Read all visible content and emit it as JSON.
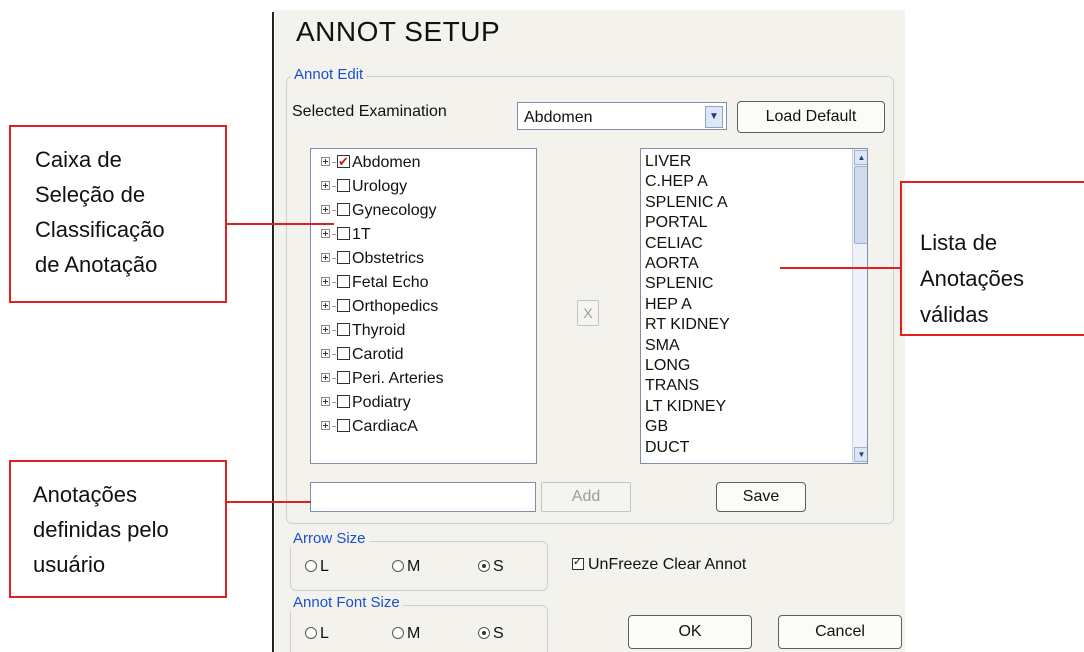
{
  "dialog": {
    "title": "ANNOT SETUP",
    "annot_edit": {
      "legend": "Annot Edit",
      "selected_examination_label": "Selected Examination",
      "selected_examination_value": "Abdomen",
      "load_default_label": "Load Default",
      "tree_items": [
        {
          "label": "Abdomen",
          "checked": true
        },
        {
          "label": "Urology",
          "checked": false
        },
        {
          "label": "Gynecology",
          "checked": false
        },
        {
          "label": "1T",
          "checked": false
        },
        {
          "label": "Obstetrics",
          "checked": false
        },
        {
          "label": "Fetal Echo",
          "checked": false
        },
        {
          "label": "Orthopedics",
          "checked": false
        },
        {
          "label": "Thyroid",
          "checked": false
        },
        {
          "label": "Carotid",
          "checked": false
        },
        {
          "label": "Peri. Arteries",
          "checked": false
        },
        {
          "label": "Podiatry",
          "checked": false
        },
        {
          "label": "CardiacA",
          "checked": false
        }
      ],
      "remove_button_label": "X",
      "annotations": [
        "LIVER",
        "C.HEP A",
        "SPLENIC A",
        "PORTAL",
        "CELIAC",
        "AORTA",
        "SPLENIC",
        "HEP A",
        "RT KIDNEY",
        "SMA",
        "LONG",
        "TRANS",
        "LT KIDNEY",
        "GB",
        "DUCT"
      ],
      "user_annotation_value": "",
      "add_button_label": "Add",
      "save_button_label": "Save"
    },
    "arrow_size": {
      "legend": "Arrow Size",
      "options": [
        "L",
        "M",
        "S"
      ],
      "selected": "S"
    },
    "annot_font_size": {
      "legend": "Annot Font Size",
      "options": [
        "L",
        "M",
        "S"
      ],
      "selected": "S"
    },
    "unfreeze_clear_annot": {
      "label": "UnFreeze Clear Annot",
      "checked": true
    },
    "ok_label": "OK",
    "cancel_label": "Cancel"
  },
  "callouts": {
    "classification": [
      "Caixa de",
      "Seleção de",
      "Classificação",
      "de Anotação"
    ],
    "annotation_list": [
      "Lista de",
      "Anotações",
      "válidas"
    ],
    "user_defined": [
      "Anotações",
      "definidas pelo",
      "usuário"
    ]
  },
  "colors": {
    "legend": "#1a4fcf",
    "callout_border": "#e02020",
    "panel_bg": "#f3f2ec",
    "checkmark": "#c21e1e"
  }
}
